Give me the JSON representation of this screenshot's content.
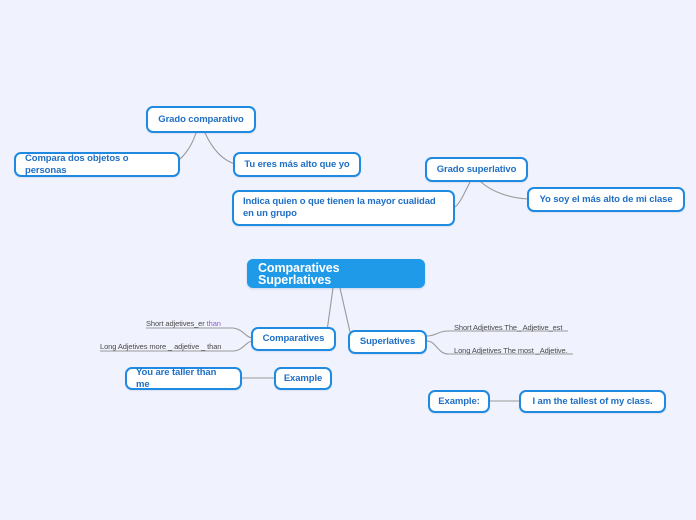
{
  "document": {
    "type": "mind-map",
    "background_color": "#f0f2fd",
    "node_border_color": "#1f8ae0",
    "node_text_color": "#1f6fc4",
    "root_fill_color": "#1f9ae8",
    "root_text_color": "#ffffff",
    "connector_color": "#9a9a9a",
    "highlight_text_color": "#8a63d2"
  },
  "root": {
    "label": "Comparatives Superlatives"
  },
  "nodes": {
    "grado_comparativo": "Grado comparativo",
    "compara_dos_objetos": "Compara dos objetos o personas",
    "tu_eres_mas_alto": "Tu eres más alto que yo",
    "indica_quien": "Indica quien o que tienen la mayor cualidad\nen un grupo",
    "grado_superlativo": "Grado superlativo",
    "yo_soy_el_mas_alto": "Yo soy el más alto de mi clase",
    "comparatives": "Comparatives",
    "superlatives": "Superlatives",
    "you_are_taller": "You are taller than me",
    "example_left": "Example",
    "example_right": "Example:",
    "i_am_the_tallest": "I am the tallest of my class."
  },
  "labels": {
    "short_adjetives_er": "Short adjetives_er ",
    "short_adjetives_er_hl": "than",
    "long_adjetives_more": "Long Adjetives more _ adjetive _ than",
    "short_adjetives_est": "Short Adjetives The_ Adjetive_est",
    "long_adjetives_most": "Long Adjetives The most _Adjetive."
  }
}
